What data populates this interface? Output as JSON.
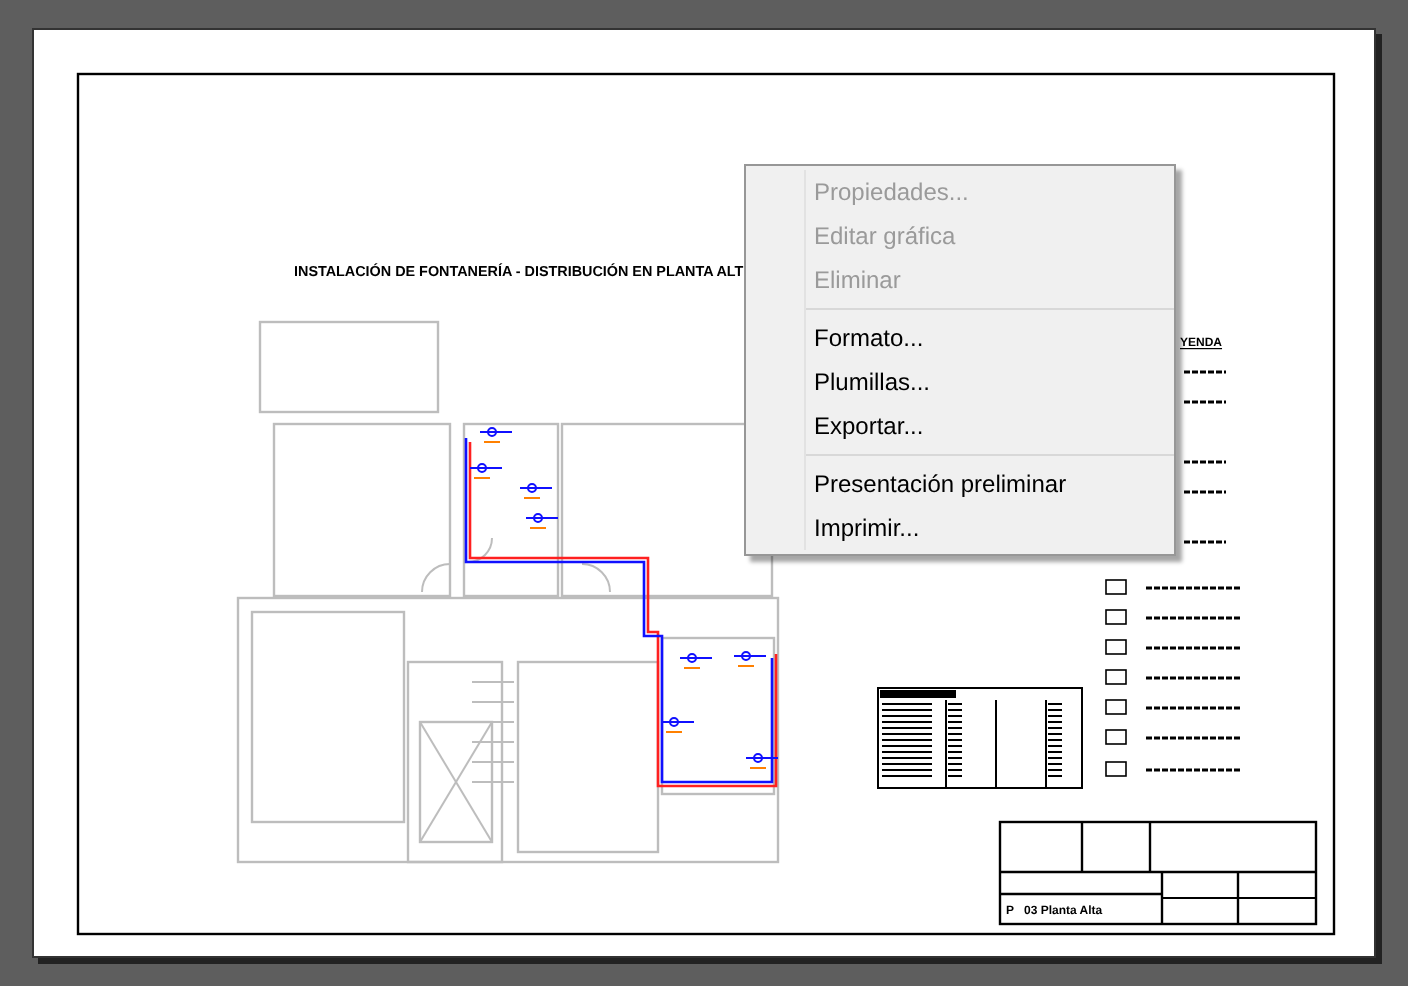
{
  "drawing": {
    "title": "INSTALACIÓN DE FONTANERÍA - DISTRIBUCIÓN EN PLANTA ALT",
    "legend_heading": "YENDA",
    "title_block": {
      "sheet_code": "P",
      "sheet_name": "03 Planta Alta"
    }
  },
  "context_menu": {
    "groups": [
      [
        {
          "label": "Propiedades...",
          "disabled": true
        },
        {
          "label": "Editar gráfica",
          "disabled": true
        },
        {
          "label": "Eliminar",
          "disabled": true
        }
      ],
      [
        {
          "label": "Formato...",
          "disabled": false
        },
        {
          "label": "Plumillas...",
          "disabled": false
        },
        {
          "label": "Exportar...",
          "disabled": false
        }
      ],
      [
        {
          "label": "Presentación preliminar",
          "disabled": false
        },
        {
          "label": "Imprimir...",
          "disabled": false
        }
      ]
    ]
  }
}
